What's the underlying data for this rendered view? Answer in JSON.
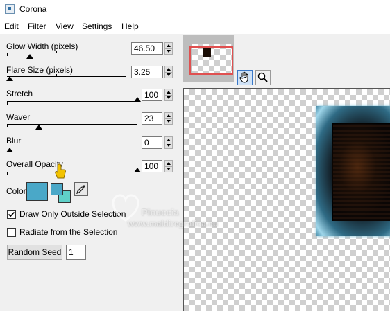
{
  "window": {
    "title": "Corona"
  },
  "menu": [
    "Edit",
    "Filter",
    "View",
    "Settings",
    "Help"
  ],
  "controls": {
    "glow_width": {
      "label": "Glow Width (pixels)",
      "value": "46.50"
    },
    "flare_size": {
      "label": "Flare Size (pixels)",
      "value": "3.25"
    },
    "stretch": {
      "label": "Stretch",
      "value": "100"
    },
    "waver": {
      "label": "Waver",
      "value": "23"
    },
    "blur": {
      "label": "Blur",
      "value": "0"
    },
    "overall_opacity": {
      "label": "Overall Opacity",
      "value": "100"
    }
  },
  "color": {
    "label": "Color",
    "primary_color": "#4aa8c8",
    "secondary_front": "#4aa8c8",
    "secondary_back": "#5fd0c8",
    "eyedropper_icon": "eyedropper-icon",
    "hand_pointer_icon": "hand-pointer-icon"
  },
  "options": {
    "draw_only_outside": {
      "label": "Draw Only Outside Selection",
      "checked": true
    },
    "radiate_from_selection": {
      "label": "Radiate from the Selection",
      "checked": false
    }
  },
  "random_seed": {
    "label": "Random Seed",
    "value": "1"
  },
  "preview_tools": {
    "pan": "hand-icon",
    "zoom": "magnifier-icon"
  },
  "watermark": {
    "line1": "Pinuccia",
    "line2": "www.maldiregrafica.eu"
  }
}
